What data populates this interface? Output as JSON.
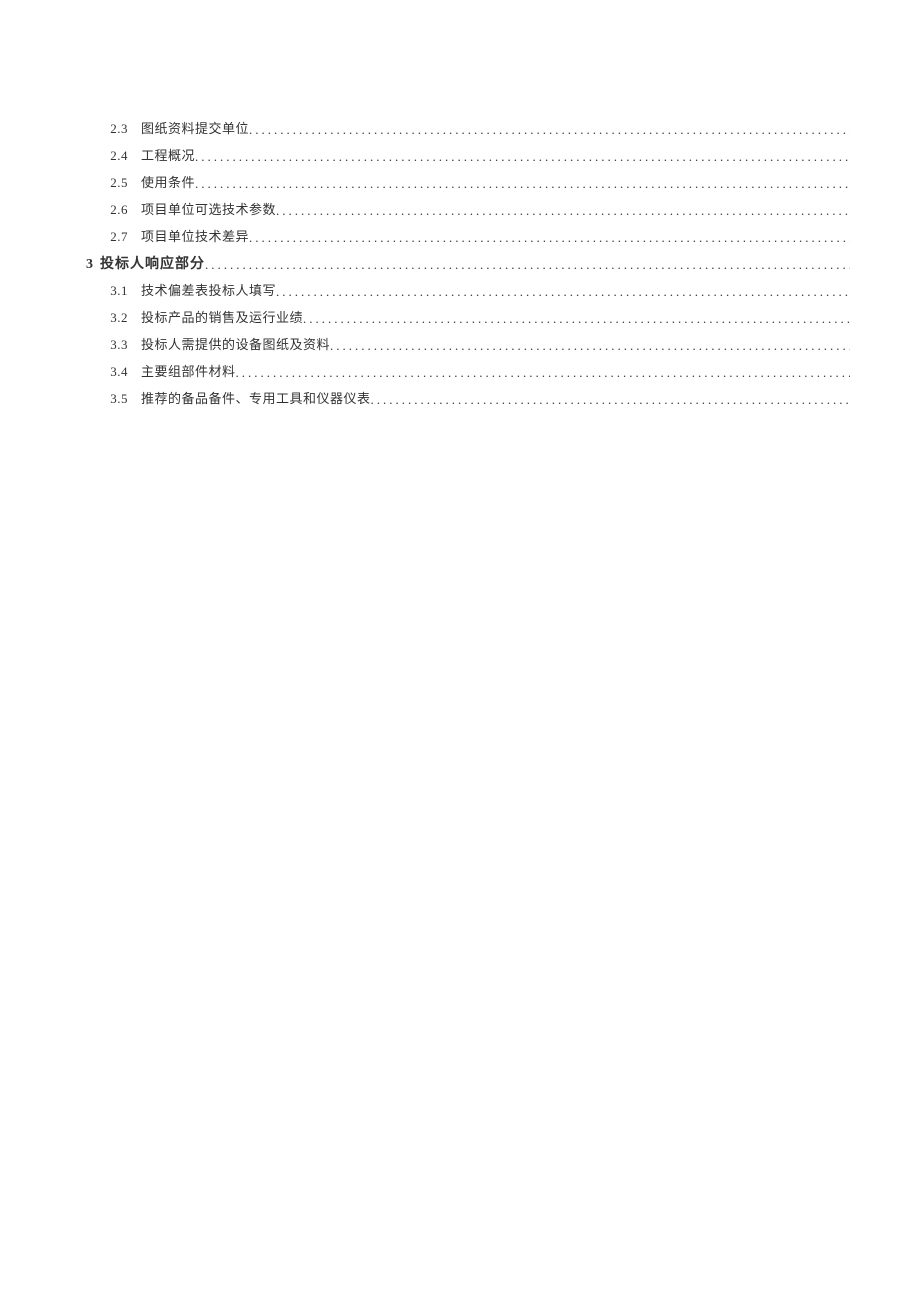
{
  "toc": {
    "entries": [
      {
        "level": "sub",
        "number": "2.3",
        "title": "图纸资料提交单位"
      },
      {
        "level": "sub",
        "number": "2.4",
        "title": "工程概况"
      },
      {
        "level": "sub",
        "number": "2.5",
        "title": "使用条件"
      },
      {
        "level": "sub",
        "number": "2.6",
        "title": "项目单位可选技术参数"
      },
      {
        "level": "sub",
        "number": "2.7",
        "title": "项目单位技术差异"
      },
      {
        "level": "top",
        "number": "3",
        "title": "投标人响应部分"
      },
      {
        "level": "sub",
        "number": "3.1",
        "title": "技术偏差表投标人填写"
      },
      {
        "level": "sub",
        "number": "3.2",
        "title": "投标产品的销售及运行业绩"
      },
      {
        "level": "sub",
        "number": "3.3",
        "title": "投标人需提供的设备图纸及资料"
      },
      {
        "level": "sub",
        "number": "3.4",
        "title": "主要组部件材料"
      },
      {
        "level": "sub",
        "number": "3.5",
        "title": "推荐的备品备件、专用工具和仪器仪表"
      }
    ]
  }
}
